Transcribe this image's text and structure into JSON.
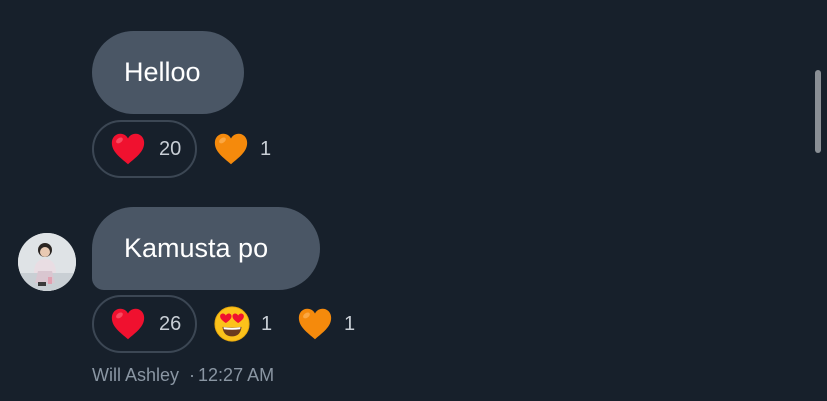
{
  "messages": [
    {
      "text": "Helloo",
      "reactions": [
        {
          "emoji": "red-heart",
          "count": "20",
          "own": true
        },
        {
          "emoji": "orange-heart",
          "count": "1",
          "own": false
        }
      ]
    },
    {
      "text": "Kamusta po",
      "reactions": [
        {
          "emoji": "red-heart",
          "count": "26",
          "own": true
        },
        {
          "emoji": "heart-eyes-face",
          "count": "1",
          "own": false
        },
        {
          "emoji": "orange-heart",
          "count": "1",
          "own": false
        }
      ]
    }
  ],
  "footer": {
    "sender": "Will Ashley",
    "separator": "·",
    "time": "12:27 AM"
  },
  "colors": {
    "background": "#17202b",
    "bubble": "#4a5665",
    "reaction_border": "#3c4754",
    "count_text": "#c8ced5",
    "meta_text": "#8a96a3",
    "red_heart": "#f0112f",
    "orange_heart": "#f58a0c"
  }
}
